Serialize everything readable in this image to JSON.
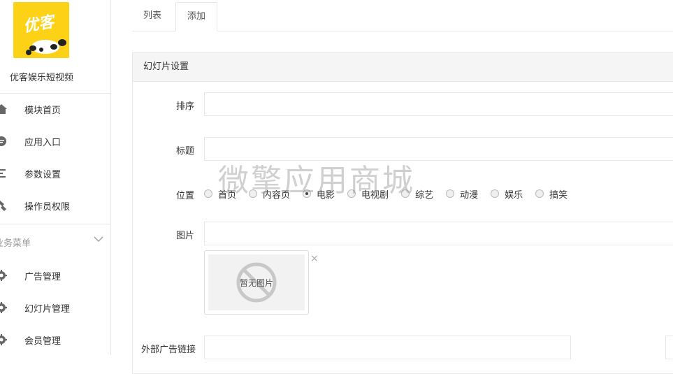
{
  "app": {
    "name": "优客娱乐短视频",
    "logo_text": "优客"
  },
  "sidebar": {
    "items": [
      {
        "label": "模块首页",
        "icon": "home-icon"
      },
      {
        "label": "应用入口",
        "icon": "chat-icon"
      },
      {
        "label": "参数设置",
        "icon": "list-icon"
      },
      {
        "label": "操作员权限",
        "icon": "key-icon"
      }
    ],
    "group_title": "业务菜单",
    "group_items": [
      {
        "label": "广告管理",
        "icon": "gear-icon"
      },
      {
        "label": "幻灯片管理",
        "icon": "gear-icon"
      },
      {
        "label": "会员管理",
        "icon": "gear-icon"
      }
    ]
  },
  "tabs": [
    {
      "label": "列表",
      "active": false
    },
    {
      "label": "添加",
      "active": true
    }
  ],
  "panel": {
    "title": "幻灯片设置",
    "fields": {
      "order_label": "排序",
      "order_value": "",
      "title_label": "标题",
      "title_value": "",
      "position_label": "位置",
      "image_label": "图片",
      "image_value": "",
      "link_label": "外部广告链接",
      "link_value": ""
    },
    "positions": [
      {
        "label": "首页",
        "checked": false
      },
      {
        "label": "内容页",
        "checked": false
      },
      {
        "label": "电影",
        "checked": true
      },
      {
        "label": "电视剧",
        "checked": false
      },
      {
        "label": "综艺",
        "checked": false
      },
      {
        "label": "动漫",
        "checked": false
      },
      {
        "label": "娱乐",
        "checked": false
      },
      {
        "label": "搞笑",
        "checked": false
      }
    ],
    "no_image_text": "暂无图片",
    "close_glyph": "×"
  },
  "watermark": "微擎应用商城",
  "colors": {
    "logo_bg": "#fcd116",
    "border": "#e6e6e6",
    "panel_head": "#f5f5f5"
  }
}
